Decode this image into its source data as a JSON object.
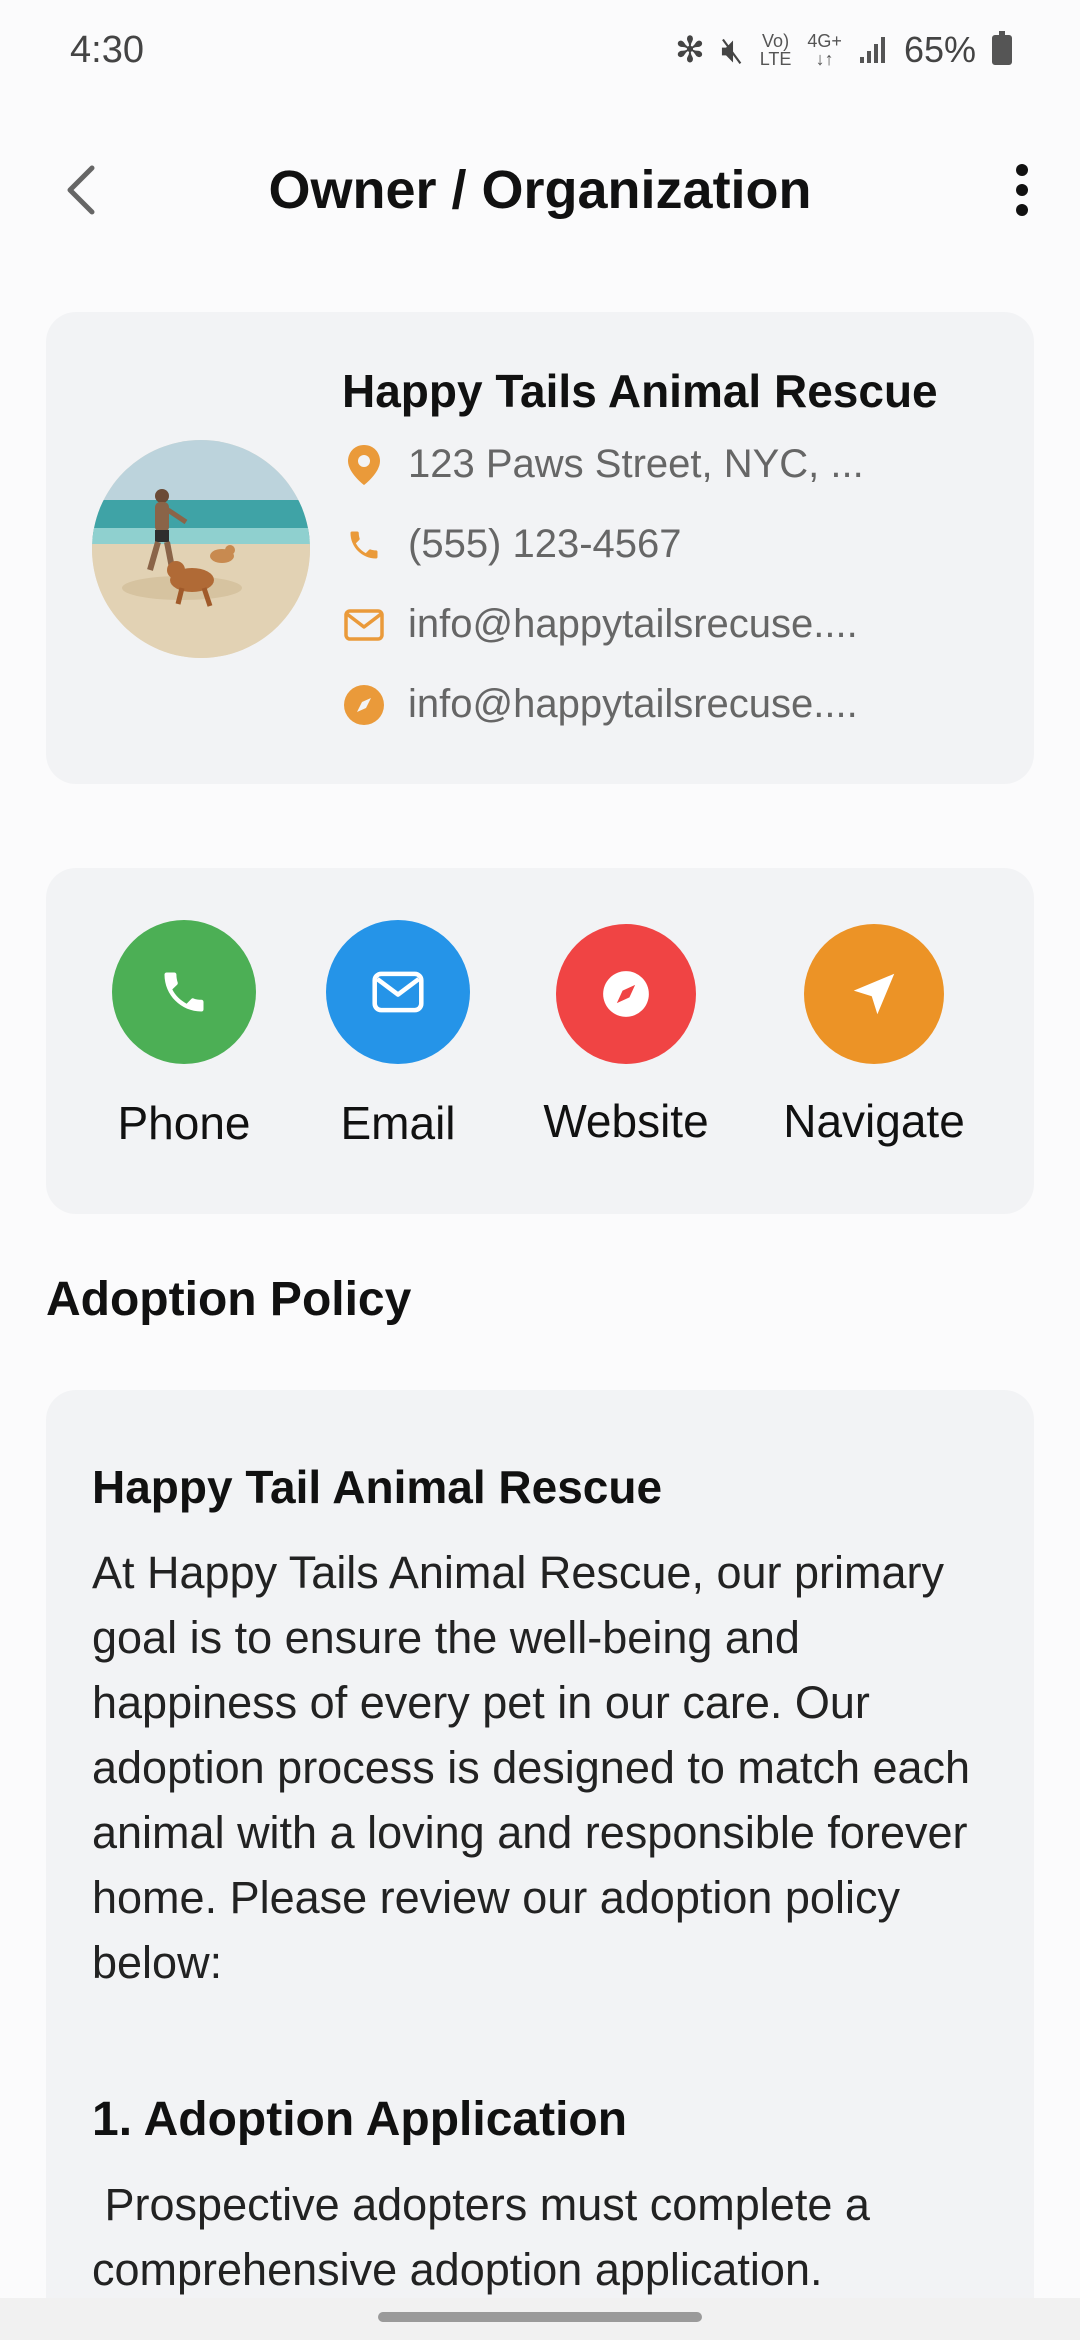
{
  "status": {
    "time": "4:30",
    "signal_text_top": "Vo)",
    "signal_text_bottom": "LTE",
    "net_top": "4G+",
    "net_bottom": "↓↑",
    "battery": "65%"
  },
  "header": {
    "title": "Owner / Organization"
  },
  "owner": {
    "name": "Happy Tails Animal Rescue",
    "address": "123 Paws Street, NYC, ...",
    "phone": "(555) 123-4567",
    "email": "info@happytailsrecuse....",
    "website": "info@happytailsrecuse....",
    "accent_color": "#ea9a3a"
  },
  "actions": [
    {
      "label": "Phone",
      "icon": "phone-icon",
      "color": "#4caf55"
    },
    {
      "label": "Email",
      "icon": "mail-icon",
      "color": "#2594e8"
    },
    {
      "label": "Website",
      "icon": "compass-icon",
      "color": "#f04444"
    },
    {
      "label": "Navigate",
      "icon": "navigate-icon",
      "color": "#ec9326"
    }
  ],
  "policy": {
    "section_title": "Adoption Policy",
    "heading": "Happy Tail Animal Rescue",
    "body": "At Happy Tails Animal Rescue, our primary goal is to ensure the well-being and happiness of every pet in our care. Our adoption process is designed to match each animal with a loving and responsible forever home. Please review our adoption policy below:",
    "sub_heading": "1. Adoption Application",
    "sub_body": " Prospective adopters must complete a comprehensive adoption application."
  }
}
